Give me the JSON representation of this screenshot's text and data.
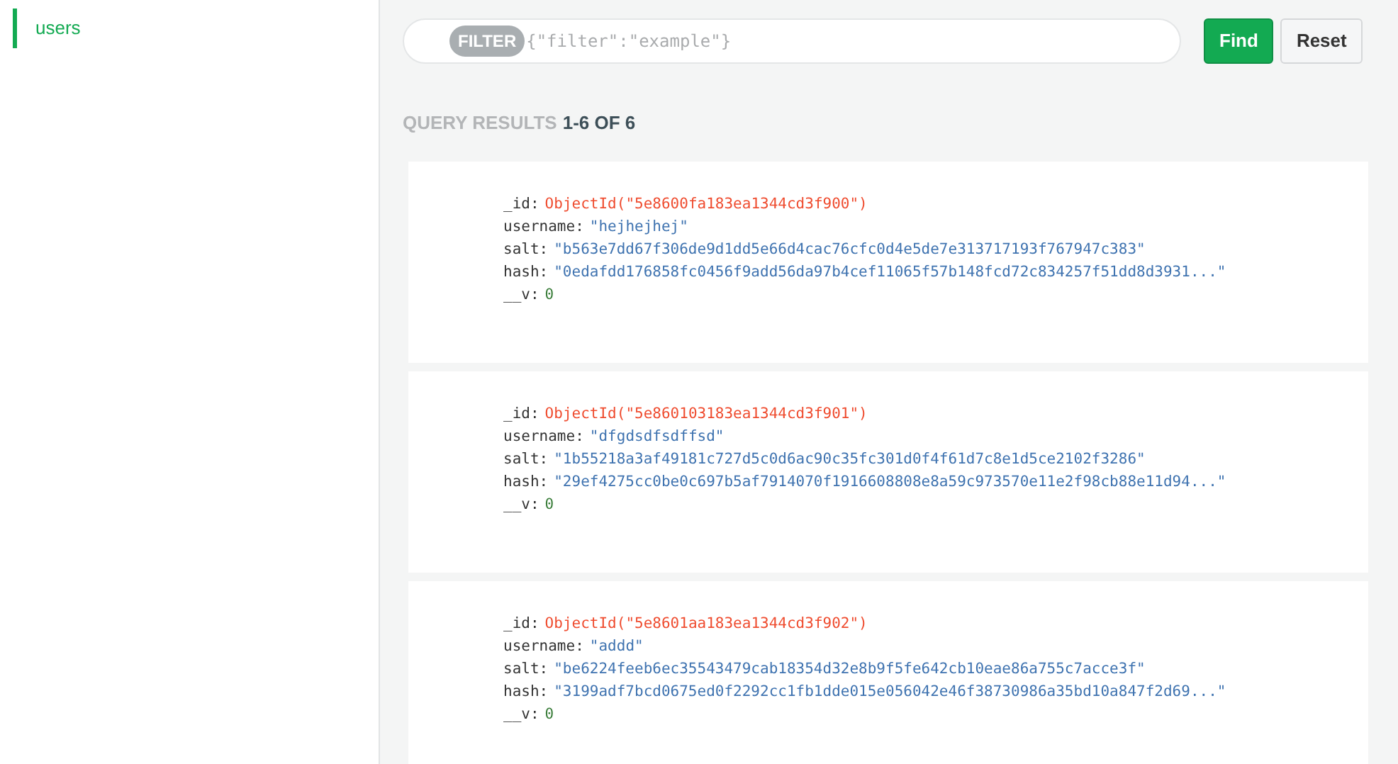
{
  "sidebar": {
    "items": [
      {
        "label": "users",
        "selected": true
      }
    ]
  },
  "filter": {
    "tag": "FILTER",
    "placeholder": "{\"filter\":\"example\"}"
  },
  "buttons": [
    {
      "label": "Find",
      "kind": "primary"
    },
    {
      "label": "Reset",
      "kind": "secondary"
    }
  ],
  "results": {
    "label": "QUERY RESULTS",
    "count": "1-6 OF 6"
  },
  "documents": [
    {
      "fields": [
        {
          "key": "_id:",
          "value": "ObjectId(\"5e8600fa183ea1344cd3f900\")",
          "kind": "objectid"
        },
        {
          "key": "username:",
          "value": "\"hejhejhej\"",
          "kind": "string"
        },
        {
          "key": "salt:",
          "value": "\"b563e7dd67f306de9d1dd5e66d4cac76cfc0d4e5de7e313717193f767947c383\"",
          "kind": "string"
        },
        {
          "key": "hash:",
          "value": "\"0edafdd176858fc0456f9add56da97b4cef11065f57b148fcd72c834257f51dd8d3931...\"",
          "kind": "string"
        },
        {
          "key": "__v:",
          "value": "0",
          "kind": "number"
        }
      ]
    },
    {
      "fields": [
        {
          "key": "_id:",
          "value": "ObjectId(\"5e860103183ea1344cd3f901\")",
          "kind": "objectid"
        },
        {
          "key": "username:",
          "value": "\"dfgdsdfsdffsd\"",
          "kind": "string"
        },
        {
          "key": "salt:",
          "value": "\"1b55218a3af49181c727d5c0d6ac90c35fc301d0f4f61d7c8e1d5ce2102f3286\"",
          "kind": "string"
        },
        {
          "key": "hash:",
          "value": "\"29ef4275cc0be0c697b5af7914070f1916608808e8a59c973570e11e2f98cb88e11d94...\"",
          "kind": "string"
        },
        {
          "key": "__v:",
          "value": "0",
          "kind": "number"
        }
      ]
    },
    {
      "fields": [
        {
          "key": "_id:",
          "value": "ObjectId(\"5e8601aa183ea1344cd3f902\")",
          "kind": "objectid"
        },
        {
          "key": "username:",
          "value": "\"addd\"",
          "kind": "string"
        },
        {
          "key": "salt:",
          "value": "\"be6224feeb6ec35543479cab18354d32e8b9f5fe642cb10eae86a755c7acce3f\"",
          "kind": "string"
        },
        {
          "key": "hash:",
          "value": "\"3199adf7bcd0675ed0f2292cc1fb1dde015e056042e46f38730986a35bd10a847f2d69...\"",
          "kind": "string"
        },
        {
          "key": "__v:",
          "value": "0",
          "kind": "number"
        }
      ]
    }
  ]
}
